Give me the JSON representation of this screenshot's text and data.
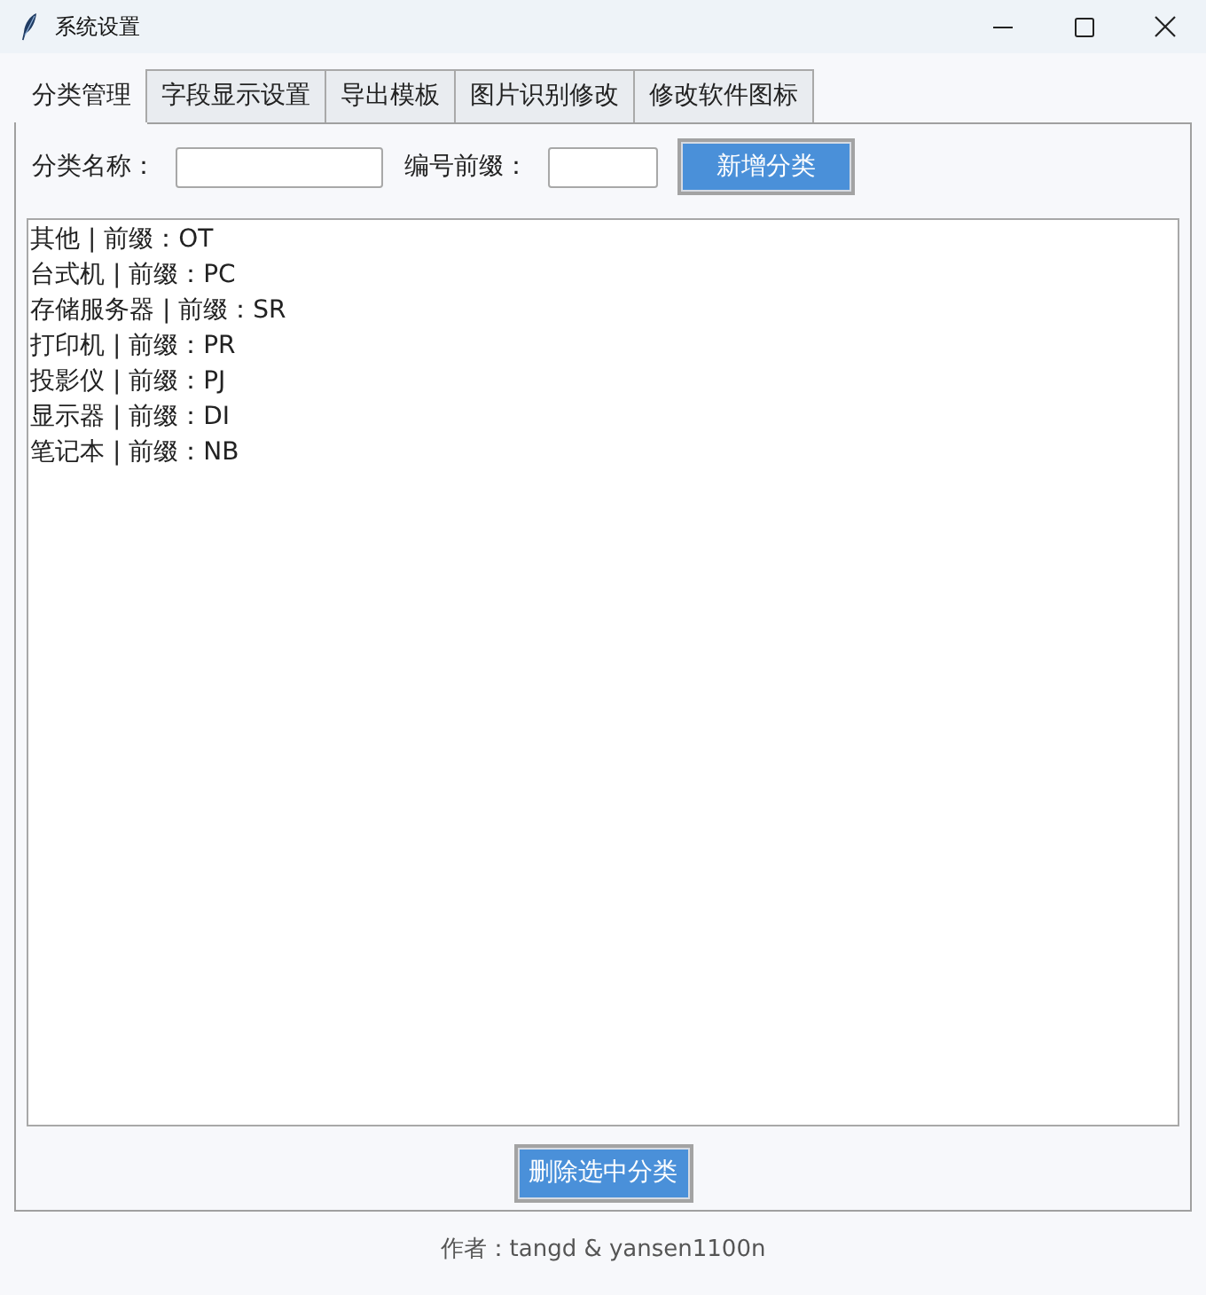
{
  "window": {
    "title": "系统设置"
  },
  "tabs": [
    {
      "label": "分类管理",
      "selected": true
    },
    {
      "label": "字段显示设置",
      "selected": false
    },
    {
      "label": "导出模板",
      "selected": false
    },
    {
      "label": "图片识别修改",
      "selected": false
    },
    {
      "label": "修改软件图标",
      "selected": false
    }
  ],
  "form": {
    "fields": [
      {
        "label": "分类名称："
      },
      {
        "label": "编号前缀："
      }
    ],
    "add_button": "新增分类"
  },
  "list": {
    "items": [
      {
        "text": "其他 | 前缀：OT",
        "selected": false
      },
      {
        "text": "台式机 | 前缀：PC",
        "selected": false
      },
      {
        "text": "存储服务器 | 前缀：SR",
        "selected": false
      },
      {
        "text": "打印机 | 前缀：PR",
        "selected": false
      },
      {
        "text": "投影仪 | 前缀：PJ",
        "selected": false
      },
      {
        "text": "显示器 | 前缀：DI",
        "selected": false
      },
      {
        "text": "笔记本 | 前缀：NB",
        "selected": false
      }
    ]
  },
  "delete_button": "删除选中分类",
  "footer": "作者：tangd & yansen1100n"
}
